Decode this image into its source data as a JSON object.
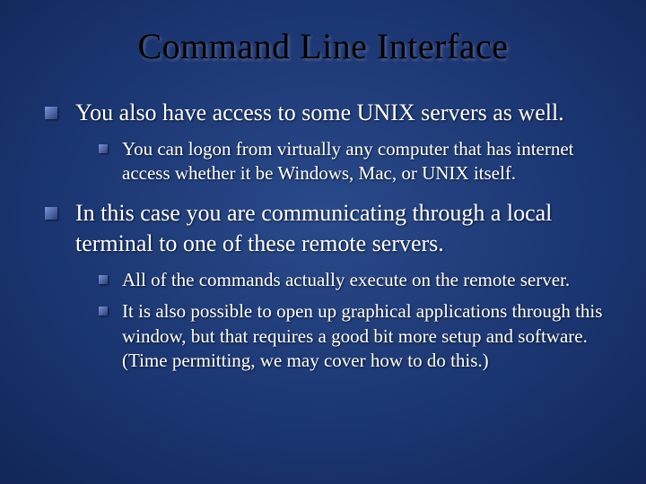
{
  "slide": {
    "title": "Command Line Interface",
    "bullets": [
      {
        "text": "You also have access to some UNIX servers as well.",
        "sub": [
          "You can logon from virtually any computer that has internet access whether it be Windows, Mac, or UNIX itself."
        ]
      },
      {
        "text": "In this case you are communicating through a local terminal to one of these remote servers.",
        "sub": [
          "All of the commands actually execute on the remote server.",
          "It is also possible to open up graphical applications through this window, but that requires a good bit more setup and software. (Time permitting, we may cover how to do this.)"
        ]
      }
    ]
  }
}
